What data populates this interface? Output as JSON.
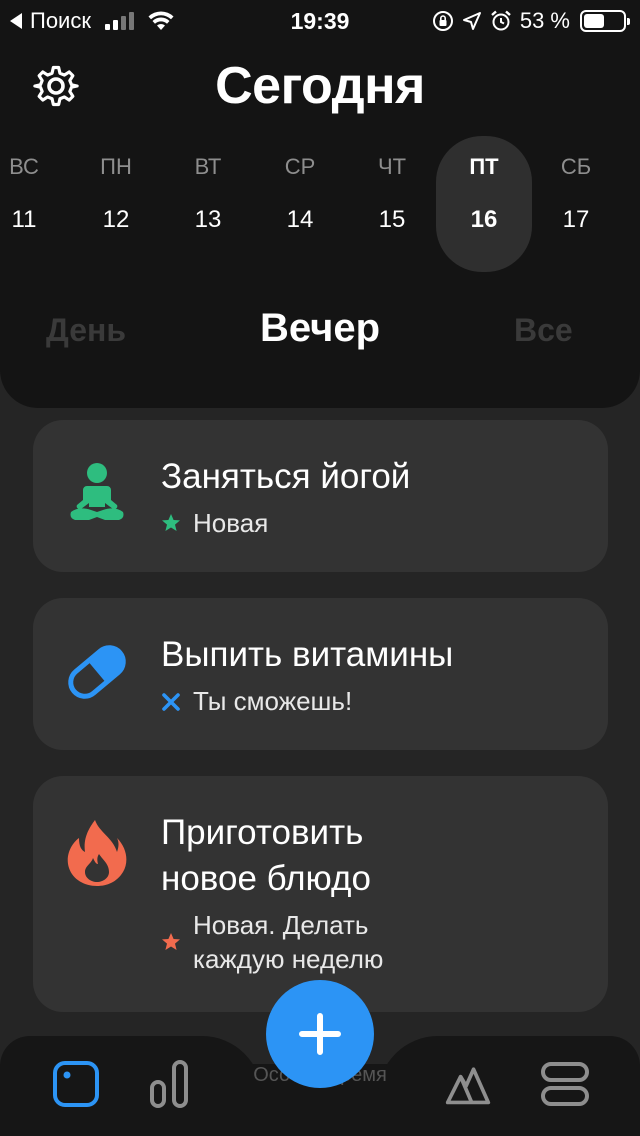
{
  "status_bar": {
    "back_label": "Поиск",
    "time": "19:39",
    "battery_percent": "53 %",
    "battery_level": 0.53
  },
  "header": {
    "title": "Сегодня",
    "settings_icon": "gear-icon"
  },
  "week": {
    "days": [
      {
        "name": "ВС",
        "date": "11"
      },
      {
        "name": "ПН",
        "date": "12"
      },
      {
        "name": "ВТ",
        "date": "13"
      },
      {
        "name": "СР",
        "date": "14"
      },
      {
        "name": "ЧТ",
        "date": "15"
      },
      {
        "name": "ПТ",
        "date": "16"
      },
      {
        "name": "СБ",
        "date": "17"
      }
    ],
    "selected_index": 5
  },
  "segments": {
    "left": "День",
    "center": "Вечер",
    "right": "Все"
  },
  "habits": [
    {
      "title": "Заняться йогой",
      "status": "Новая",
      "icon": "yoga-icon",
      "status_icon": "star-icon",
      "color": "#2ebd7f"
    },
    {
      "title_line1": "Выпить витамины",
      "status": "Ты сможешь!",
      "icon": "pill-icon",
      "status_icon": "cross-icon",
      "color": "#2c94f5"
    },
    {
      "title_line1": "Приготовить",
      "title_line2": "новое блюдо",
      "status_line1": "Новая. Делать",
      "status_line2": "каждую неделю",
      "icon": "fire-icon",
      "status_icon": "star-icon",
      "color": "#f26b4e"
    }
  ],
  "tabbar": {
    "hidden_label": "Особое время",
    "tabs": [
      "today-icon",
      "stats-icon",
      "challenges-icon",
      "settings-menu-icon"
    ],
    "add_icon": "plus-icon",
    "accent": "#2c94f5"
  }
}
